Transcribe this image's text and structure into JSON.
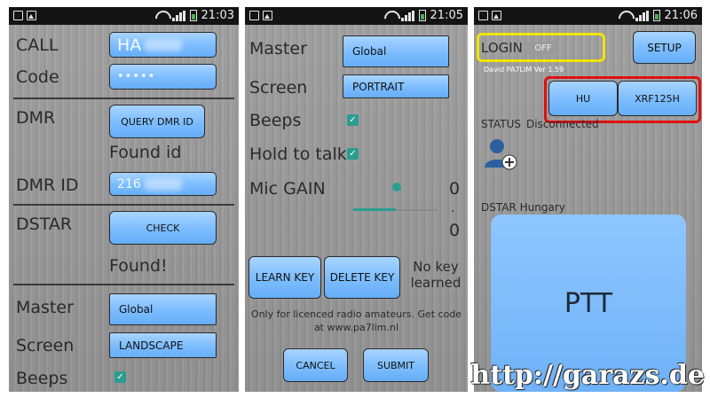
{
  "status_bar": {
    "time_1": "21:03",
    "time_2": "21:05",
    "time_3": "21:06"
  },
  "screen1": {
    "call_label": "CALL",
    "call_value": "HA",
    "code_label": "Code",
    "code_value": "•••••",
    "dmr_label": "DMR",
    "query_button": "QUERY DMR ID",
    "found_id_text": "Found id",
    "dmr_id_label": "DMR ID",
    "dmr_id_value": "216",
    "dstar_label": "DSTAR",
    "check_button": "CHECK",
    "found_text": "Found!",
    "master_label": "Master",
    "master_value": "Global",
    "screen_label": "Screen",
    "screen_value": "LANDSCAPE",
    "beeps_label": "Beeps"
  },
  "screen2": {
    "master_label": "Master",
    "master_value": "Global",
    "screen_label": "Screen",
    "screen_value": "PORTRAIT",
    "beeps_label": "Beeps",
    "hold_label": "Hold to talk",
    "mic_label": "Mic GAIN",
    "mic_value": "0",
    "mic_dot": ".",
    "mic_value2": "0",
    "mic_level": 0,
    "learn_button": "LEARN KEY",
    "delete_button": "DELETE KEY",
    "no_key_text": "No key learned",
    "notice_text": "Only for licenced radio amateurs. Get code at www.pa7lim.nl",
    "cancel_button": "CANCEL",
    "submit_button": "SUBMIT"
  },
  "screen3": {
    "login_label": "LOGIN",
    "toggle_state": "OFF",
    "setup_button": "SETUP",
    "version_text": "David PA7LIM  Ver 1.59",
    "country_button": "HU",
    "reflector_button": "XRF125H",
    "status_label": "STATUS",
    "status_value": "Disconnected",
    "dstar_text": "DSTAR Hungary",
    "ptt_button": "PTT"
  },
  "watermark": "http://garazs.de",
  "colors": {
    "accent_button": "#7bbcff",
    "checkbox": "#2a9d8f",
    "highlight_yellow": "#f0e400",
    "highlight_red": "#e01010"
  }
}
